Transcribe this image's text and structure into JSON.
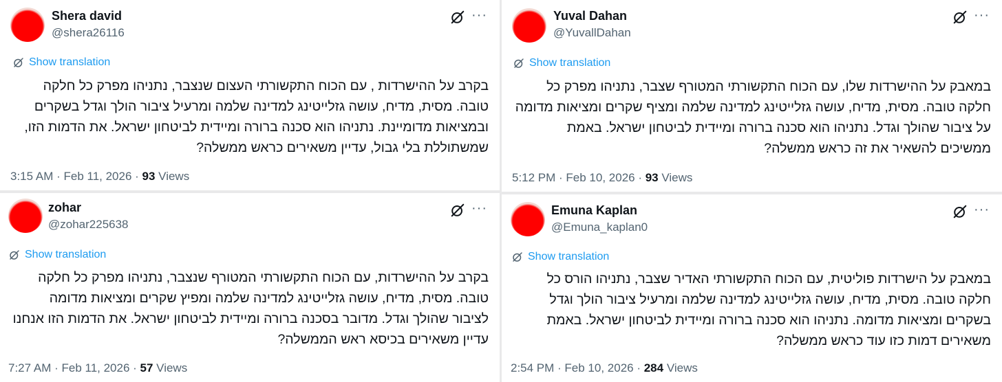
{
  "colors": {
    "link": "#1d9bf0",
    "secondary_text": "#536471",
    "primary_text": "#0f1419",
    "avatar": "#ff0000"
  },
  "tweets": [
    {
      "name": "Shera david",
      "handle": "@shera26116",
      "translate_label": "Show translation",
      "text": "בקרב על ההישרדות , עם הכוח התקשורתי העצום שנצבר, נתניהו מפרק כל חלקה טובה. מסית, מדיח, עושה גזלייטינג למדינה שלמה ומרעיל ציבור הולך וגדל בשקרים ובמציאות מדומיינת. נתניהו הוא סכנה ברורה ומיידית לביטחון ישראל. את הדמות הזו, שמשתוללת בלי גבול, עדיין משאירים כראש ממשלה?",
      "time": "3:15 AM · Feb 11, 2026 · ",
      "views": "93",
      "views_label": " Views"
    },
    {
      "name": "Yuval Dahan",
      "handle": "@YuvallDahan",
      "translate_label": "Show translation",
      "text": "במאבק על ההישרדות שלו, עם הכוח התקשורתי המטורף שצבר, נתניהו מפרק כל חלקה טובה. מסית, מדיח, עושה גזלייטינג למדינה שלמה ומציף שקרים ומציאות מדומה על ציבור שהולך וגדל. נתניהו הוא סכנה ברורה ומיידית לביטחון ישראל. באמת ממשיכים להשאיר את זה כראש ממשלה?",
      "time": "5:12 PM · Feb 10, 2026 · ",
      "views": "93",
      "views_label": " Views"
    },
    {
      "name": "zohar",
      "handle": "@zohar225638",
      "translate_label": "Show translation",
      "text": "בקרב על ההישרדות, עם הכוח התקשורתי המטורף שנצבר, נתניהו מפרק כל חלקה טובה. מסית, מדיח, עושה גזלייטינג למדינה שלמה ומפיץ שקרים ומציאות מדומה לציבור שהולך וגדל. מדובר בסכנה ברורה ומיידית לביטחון ישראל. את הדמות הזו אנחנו עדיין משאירים בכיסא ראש הממשלה?",
      "time": "7:27 AM · Feb 11, 2026 · ",
      "views": "57",
      "views_label": " Views"
    },
    {
      "name": "Emuna Kaplan",
      "handle": "@Emuna_kaplan0",
      "translate_label": "Show translation",
      "text": "במאבק על הישרדות פוליטית, עם הכוח התקשורתי האדיר שצבר, נתניהו הורס כל חלקה טובה. מסית, מדיח, עושה גזלייטינג למדינה שלמה ומרעיל ציבור הולך וגדל בשקרים ומציאות מדומה. נתניהו הוא סכנה ברורה ומיידית לביטחון ישראל. באמת משאירים דמות כזו עוד כראש ממשלה?",
      "time": "2:54 PM · Feb 10, 2026 · ",
      "views": "284",
      "views_label": " Views"
    }
  ]
}
